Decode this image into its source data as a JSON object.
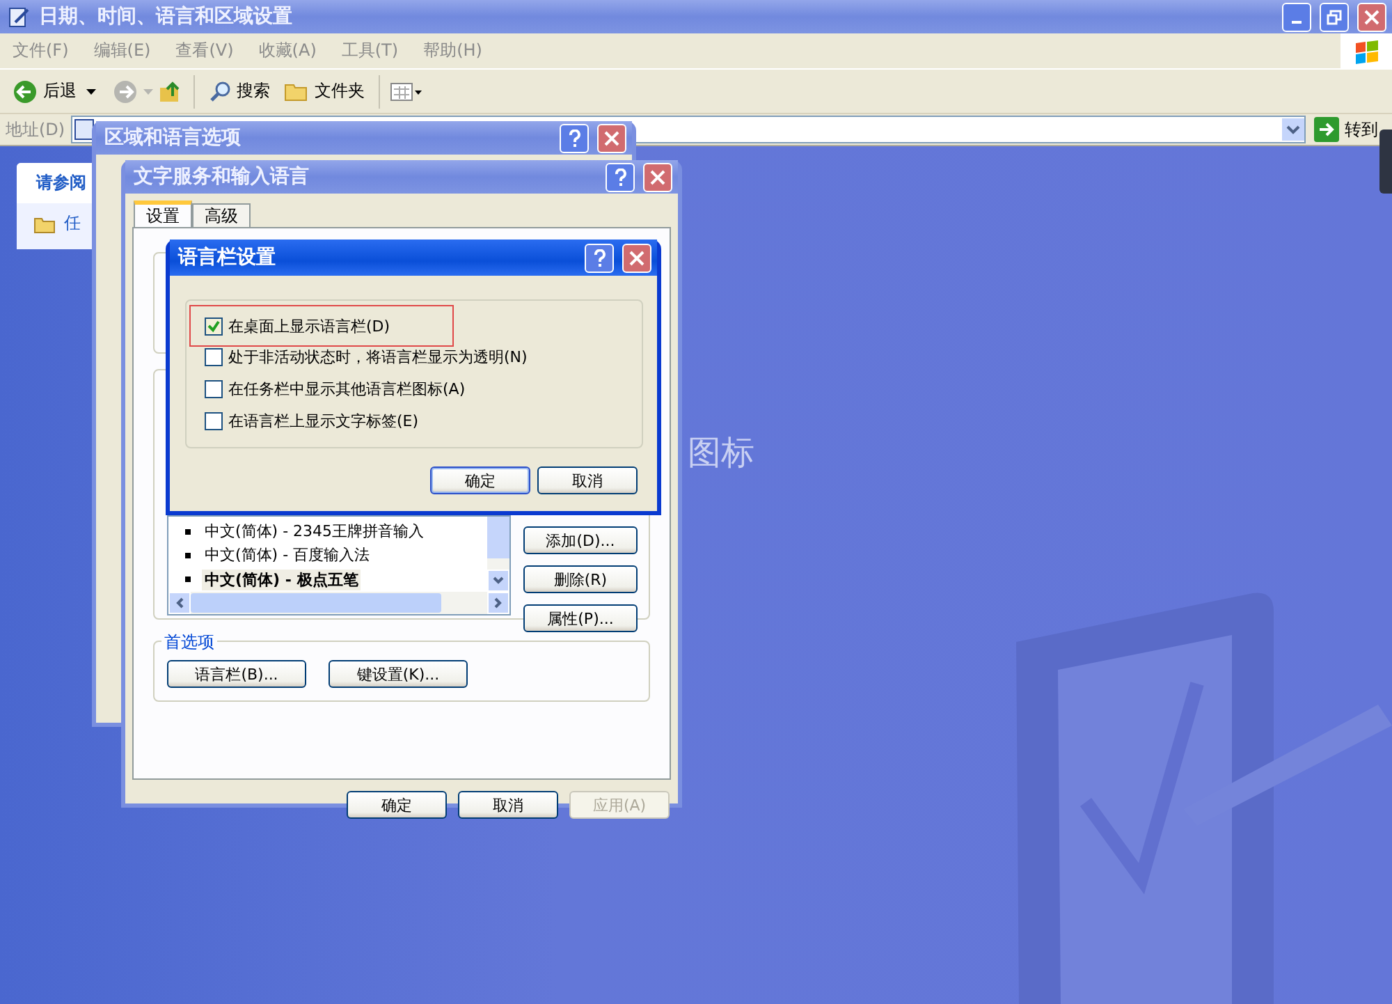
{
  "explorer": {
    "title": "日期、时间、语言和区域设置",
    "menu": [
      "文件(F)",
      "编辑(E)",
      "查看(V)",
      "收藏(A)",
      "工具(T)",
      "帮助(H)"
    ],
    "toolbar": {
      "back": "后退",
      "search": "搜索",
      "folders": "文件夹"
    },
    "address": {
      "label": "地址(D)",
      "go": "转到"
    },
    "see_also": {
      "title": "请参阅",
      "item": "任"
    },
    "heading_fragment": "图标"
  },
  "region_dialog": {
    "title": "区域和语言选项"
  },
  "text_services_dialog": {
    "title": "文字服务和输入语言",
    "tabs": [
      {
        "label": "设置",
        "selected": true
      },
      {
        "label": "高级",
        "selected": false
      }
    ],
    "services": [
      {
        "label": "中文(简体) - 2345王牌拼音输入",
        "selected": false
      },
      {
        "label": "中文(简体) - 百度输入法",
        "selected": false
      },
      {
        "label": "中文(简体) - 极点五笔",
        "selected": true
      }
    ],
    "service_buttons": [
      "添加(D)...",
      "删除(R)",
      "属性(P)..."
    ],
    "preferences": {
      "title": "首选项",
      "buttons": [
        "语言栏(B)...",
        "键设置(K)..."
      ]
    },
    "buttons": [
      {
        "label": "确定",
        "disabled": false
      },
      {
        "label": "取消",
        "disabled": false
      },
      {
        "label": "应用(A)",
        "disabled": true
      }
    ]
  },
  "langbar_dialog": {
    "title": "语言栏设置",
    "options": [
      {
        "label": "在桌面上显示语言栏(D)",
        "checked": true,
        "highlighted": true
      },
      {
        "label": "处于非活动状态时，将语言栏显示为透明(N)",
        "checked": false,
        "highlighted": false
      },
      {
        "label": "在任务栏中显示其他语言栏图标(A)",
        "checked": false,
        "highlighted": false
      },
      {
        "label": "在语言栏上显示文字标签(E)",
        "checked": false,
        "highlighted": false
      }
    ],
    "buttons": [
      "确定",
      "取消"
    ]
  }
}
